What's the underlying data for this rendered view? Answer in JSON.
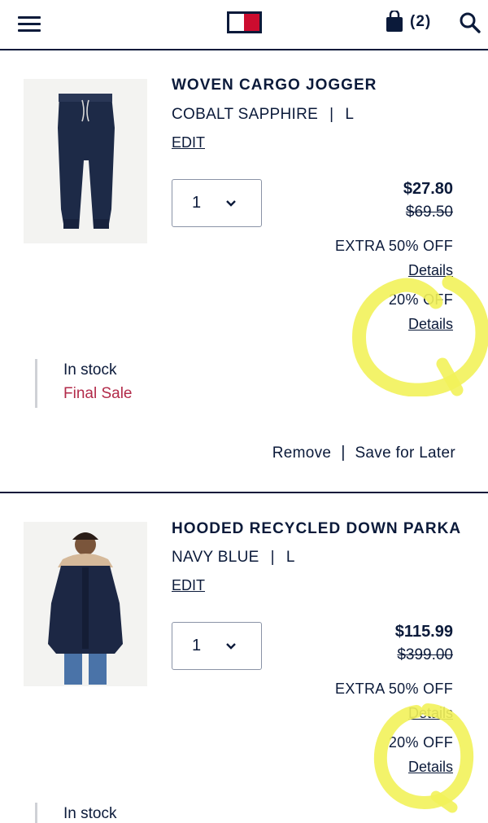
{
  "header": {
    "menu_icon": "hamburger-menu-icon",
    "logo_icon": "tommy-hilfiger-flag-logo",
    "bag_icon": "shopping-bag-icon",
    "bag_count": "(2)",
    "search_icon": "search-icon"
  },
  "colors": {
    "navy": "#0b1a3a",
    "final_sale": "#b22a49",
    "logo_red": "#cc0c2f",
    "highlight_yellow": "#f2f25a"
  },
  "items": [
    {
      "name": "WOVEN CARGO JOGGER",
      "color": "COBALT SAPPHIRE",
      "separator": "|",
      "size": "L",
      "edit_label": "EDIT",
      "quantity": "1",
      "price": "$27.80",
      "original_price": "$69.50",
      "promo1": "EXTRA 50% OFF",
      "details1": "Details",
      "promo2": "20% OFF",
      "details2": "Details",
      "stock": "In stock",
      "final_sale": "Final Sale",
      "remove_label": "Remove",
      "actions_separator": "|",
      "save_label": "Save for Later"
    },
    {
      "name": "HOODED RECYCLED DOWN PARKA",
      "color": "NAVY BLUE",
      "separator": "|",
      "size": "L",
      "edit_label": "EDIT",
      "quantity": "1",
      "price": "$115.99",
      "original_price": "$399.00",
      "promo1": "EXTRA 50% OFF",
      "details1": "Details",
      "promo2": "20% OFF",
      "details2": "Details",
      "stock": "In stock"
    }
  ]
}
